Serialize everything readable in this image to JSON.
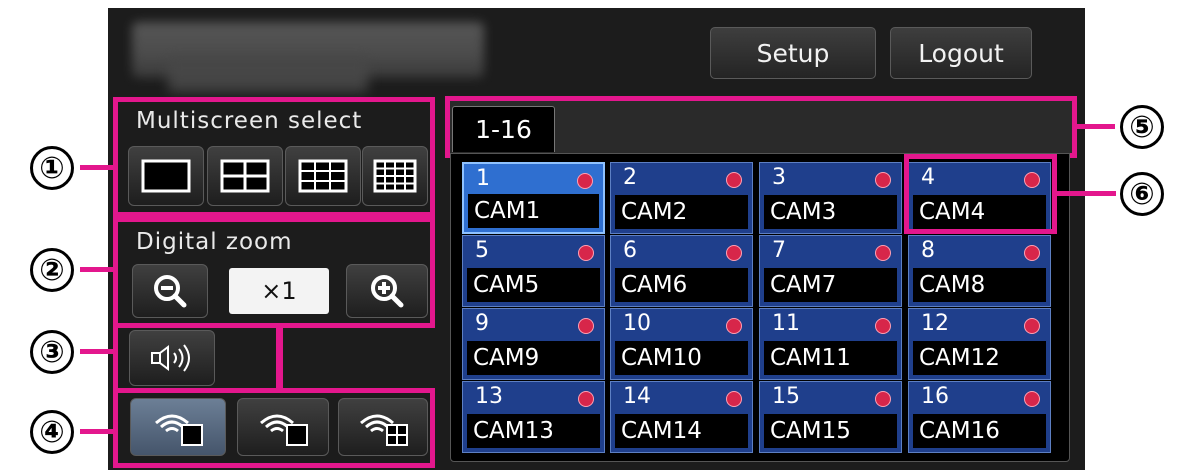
{
  "header": {
    "setup_label": "Setup",
    "logout_label": "Logout"
  },
  "multiscreen": {
    "label": "Multiscreen select"
  },
  "zoom": {
    "label": "Digital zoom",
    "value": "×1"
  },
  "tabs": [
    {
      "label": "1-16"
    }
  ],
  "cameras": [
    {
      "num": "1",
      "name": "CAM1"
    },
    {
      "num": "2",
      "name": "CAM2"
    },
    {
      "num": "3",
      "name": "CAM3"
    },
    {
      "num": "4",
      "name": "CAM4"
    },
    {
      "num": "5",
      "name": "CAM5"
    },
    {
      "num": "6",
      "name": "CAM6"
    },
    {
      "num": "7",
      "name": "CAM7"
    },
    {
      "num": "8",
      "name": "CAM8"
    },
    {
      "num": "9",
      "name": "CAM9"
    },
    {
      "num": "10",
      "name": "CAM10"
    },
    {
      "num": "11",
      "name": "CAM11"
    },
    {
      "num": "12",
      "name": "CAM12"
    },
    {
      "num": "13",
      "name": "CAM13"
    },
    {
      "num": "14",
      "name": "CAM14"
    },
    {
      "num": "15",
      "name": "CAM15"
    },
    {
      "num": "16",
      "name": "CAM16"
    }
  ],
  "callouts": {
    "c1": "①",
    "c2": "②",
    "c3": "③",
    "c4": "④",
    "c5": "⑤",
    "c6": "⑥"
  },
  "colors": {
    "highlight": "#e3178d",
    "cam_tile": "#1f3f8c",
    "cam_selected": "#2f6fd0",
    "status_dot": "#d7264a"
  }
}
